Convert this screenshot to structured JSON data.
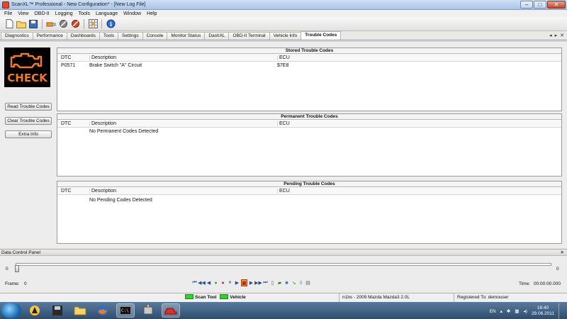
{
  "window": {
    "title": "ScanXL™ Professional - New Configuration* - [New Log File]"
  },
  "menu": [
    "File",
    "View",
    "OBD-II",
    "Logging",
    "Tools",
    "Language",
    "Window",
    "Help"
  ],
  "toolbar": {
    "icons": [
      "new-file-icon",
      "open-folder-icon",
      "save-icon",
      "connect-icon",
      "gear-icon",
      "tools-icon",
      "grid-icon",
      "info-icon"
    ]
  },
  "tabs": [
    "Diagnostics",
    "Performance",
    "Dashboards",
    "Tools",
    "Settings",
    "Console",
    "Monitor Status",
    "DashXL",
    "OBD-II Terminal",
    "Vehicle Info",
    "Trouble Codes"
  ],
  "active_tab": "Trouble Codes",
  "check_engine": {
    "text": "CHECK",
    "color": "#f07a1d"
  },
  "side_buttons": {
    "read": "Read Trouble Codes",
    "clear": "Clear Trouble Codes",
    "extra": "Extra Info"
  },
  "panels": {
    "stored": {
      "title": "Stored Trouble Codes",
      "columns": {
        "dtc": "DTC",
        "description": "Description",
        "ecu": "ECU"
      },
      "rows": [
        {
          "dtc": "P0571",
          "description": "Brake Switch \"A\" Circuit",
          "ecu": "$7E8"
        }
      ]
    },
    "permanent": {
      "title": "Permanent Trouble Codes",
      "columns": {
        "dtc": "DTC",
        "description": "Description",
        "ecu": "ECU"
      },
      "message": "No Permanent Codes Detected"
    },
    "pending": {
      "title": "Pending Trouble Codes",
      "columns": {
        "dtc": "DTC",
        "description": "Description",
        "ecu": "ECU"
      },
      "message": "No Pending Codes Detected"
    }
  },
  "data_control": {
    "title": "Data Control Panel",
    "slider_min": "0",
    "slider_max": "0",
    "frame_label": "Frame:",
    "frame_value": "0",
    "time_label": "Time:",
    "time_value": "00:00:00.000"
  },
  "status": {
    "scan_tool": "Scan Tool",
    "vehicle": "Vehicle",
    "vehicle_info": "n1bs - 2009 Mazda Mazda3 2.0L",
    "registered": "Registered To: demouser"
  },
  "taskbar": {
    "lang": "EN",
    "time": "16:40",
    "date": "29.06.2011"
  }
}
